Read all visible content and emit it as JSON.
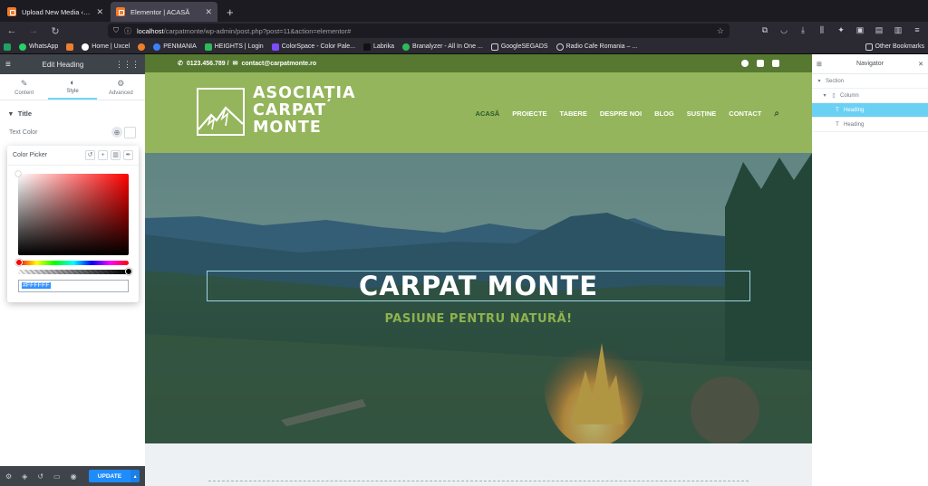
{
  "browser": {
    "tabs": [
      {
        "label": "Upload New Media ‹ Asociația",
        "active": false
      },
      {
        "label": "Elementor | ACASĂ",
        "active": true
      }
    ],
    "new_tab": "+",
    "url_host": "localhost",
    "url_path": "/carpatmonte/wp-admin/post.php?post=11&action=elementor#",
    "bookmarks": [
      "WhatsApp",
      "Home | Uxcel",
      "PENMANIA",
      "HEIGHTS | Login",
      "ColorSpace - Color Pale...",
      "Labrika",
      "Branalyzer - All In One ...",
      "GoogleSEGADS",
      "Radio Cafe Romania – ..."
    ],
    "other_bookmarks": "Other Bookmarks"
  },
  "panel": {
    "title": "Edit Heading",
    "tabs": [
      "Content",
      "Style",
      "Advanced"
    ],
    "active_tab": "Style",
    "section": "Title",
    "text_color_label": "Text Color",
    "picker": {
      "title": "Color Picker",
      "hex_value": "#FFFFFF"
    },
    "update_label": "UPDATE"
  },
  "site": {
    "phone": "0123.456.789 /",
    "email": "contact@carpatmonte.ro",
    "brand_line1": "ASOCIAȚIA",
    "brand_line2": "CARPAT",
    "brand_line3": "MONTE",
    "menu": [
      "ACASĂ",
      "PROIECTE",
      "TABERE",
      "DESPRE NOI",
      "BLOG",
      "SUSȚINE",
      "CONTACT"
    ],
    "hero_title": "CARPAT MONTE",
    "hero_subtitle": "PASIUNE PENTRU NATURĂ!"
  },
  "navigator": {
    "title": "Navigator",
    "items": [
      {
        "label": "Section",
        "level": 0,
        "selected": false
      },
      {
        "label": "Column",
        "level": 1,
        "selected": false
      },
      {
        "label": "Heading",
        "level": 2,
        "selected": true
      },
      {
        "label": "Heading",
        "level": 2,
        "selected": false
      }
    ]
  },
  "colors": {
    "topbar_green": "#567830",
    "header_green": "#94b55b",
    "accent_blue": "#1e8cfd",
    "selection_blue": "#6bd1f4"
  }
}
